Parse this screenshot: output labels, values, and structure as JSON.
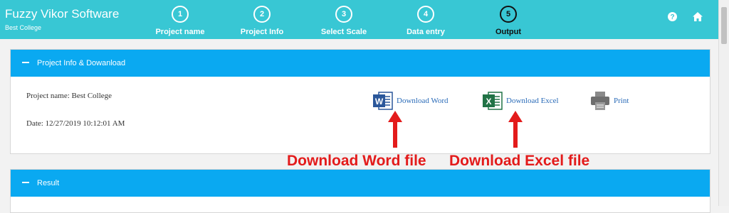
{
  "app": {
    "title": "Fuzzy Vikor Software",
    "subtitle": "Best College"
  },
  "steps": [
    {
      "num": "1",
      "label": "Project name"
    },
    {
      "num": "2",
      "label": "Project Info"
    },
    {
      "num": "3",
      "label": "Select Scale"
    },
    {
      "num": "4",
      "label": "Data entry"
    },
    {
      "num": "5",
      "label": "Output"
    }
  ],
  "active_step": 5,
  "header_icons": [
    "help-icon",
    "home-icon"
  ],
  "panel_info": {
    "title": "Project Info & Dowanload",
    "project_name": "Project name: Best College",
    "date": "Date: 12/27/2019 10:12:01 AM",
    "download_word": "Download Word",
    "download_excel": "Download Excel",
    "print": "Print"
  },
  "annotations": {
    "word": "Download Word file",
    "excel": "Download Excel file"
  },
  "panel_result": {
    "title": "Result"
  },
  "colors": {
    "topbar": "#38c7d4",
    "panel_header": "#0aa9f1",
    "link": "#2a6bb8",
    "annotation": "#e31b1b",
    "word": "#2b579a",
    "excel": "#217346"
  }
}
